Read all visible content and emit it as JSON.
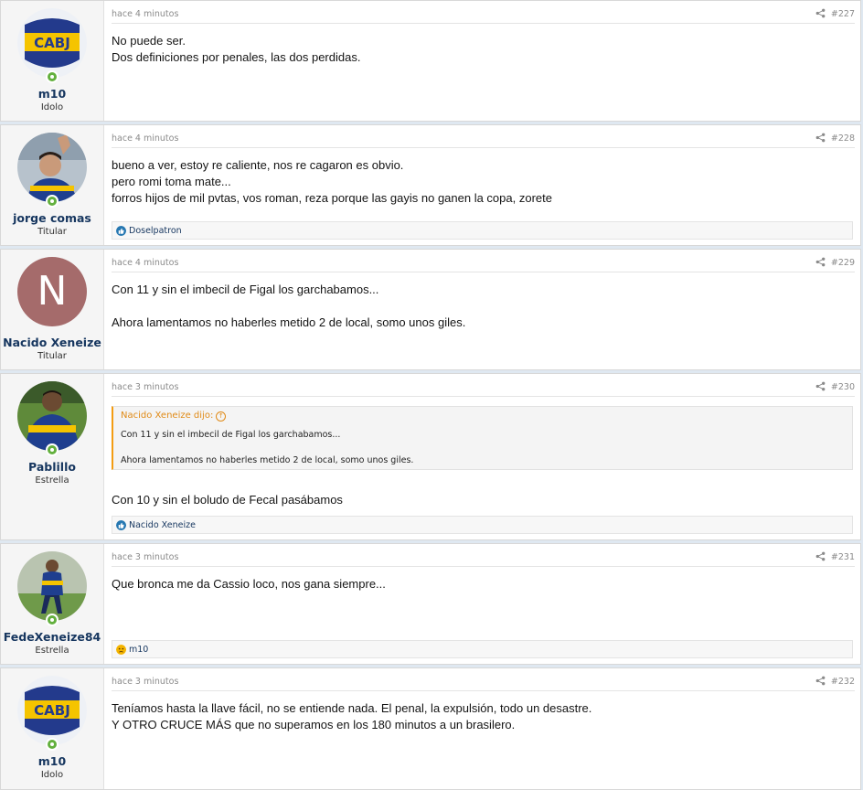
{
  "colors": {
    "page_bg": "#dfe8f1",
    "username": "#16365f",
    "quote_accent": "#f39c12",
    "online": "#63b03e",
    "like": "#2577b1",
    "sad": "#f4b400"
  },
  "posts": [
    {
      "username": "m10",
      "user_title": "Idolo",
      "avatar": "cabj-logo",
      "time": "hace 4 minutos",
      "number": "#227",
      "lines": [
        "No puede ser.",
        "Dos definiciones por penales, las dos perdidas."
      ]
    },
    {
      "username": "jorge comas",
      "user_title": "Titular",
      "avatar": "player-photo",
      "time": "hace 4 minutos",
      "number": "#228",
      "lines": [
        "bueno a ver, estoy re caliente, nos re cagaron es obvio.",
        "pero romi toma mate...",
        "forros hijos de mil pvtas, vos roman, reza porque las gayis no ganen la copa, zorete"
      ],
      "reaction": {
        "icon": "like-icon",
        "names": "Doselpatron"
      }
    },
    {
      "username": "Nacido Xeneize",
      "user_title": "Titular",
      "avatar": "letter",
      "avatar_letter": "N",
      "time": "hace 4 minutos",
      "number": "#229",
      "lines": [
        "Con 11 y sin el imbecil de Figal los garchabamos...",
        "",
        "Ahora lamentamos no haberles metido 2 de local, somo unos giles."
      ]
    },
    {
      "username": "Pablillo",
      "user_title": "Estrella",
      "avatar": "player-photo",
      "time": "hace 3 minutos",
      "number": "#230",
      "quote": {
        "author": "Nacido Xeneize dijo:",
        "lines": [
          "Con 11 y sin el imbecil de Figal los garchabamos...",
          "",
          "Ahora lamentamos no haberles metido 2 de local, somo unos giles."
        ]
      },
      "lines": [
        "Con 10 y sin el boludo de Fecal pasábamos"
      ],
      "reaction": {
        "icon": "like-icon",
        "names": "Nacido Xeneize"
      }
    },
    {
      "username": "FedeXeneize84",
      "user_title": "Estrella",
      "avatar": "player-photo",
      "time": "hace 3 minutos",
      "number": "#231",
      "lines": [
        "Que bronca me da Cassio loco, nos gana siempre..."
      ],
      "reaction": {
        "icon": "sad-icon",
        "names": "m10"
      }
    },
    {
      "username": "m10",
      "user_title": "Idolo",
      "avatar": "cabj-logo",
      "time": "hace 3 minutos",
      "number": "#232",
      "lines": [
        "Teníamos hasta la llave fácil, no se entiende nada. El penal, la expulsión, todo un desastre.",
        "Y OTRO CRUCE MÁS que no superamos en los 180 minutos a un brasilero."
      ]
    }
  ]
}
